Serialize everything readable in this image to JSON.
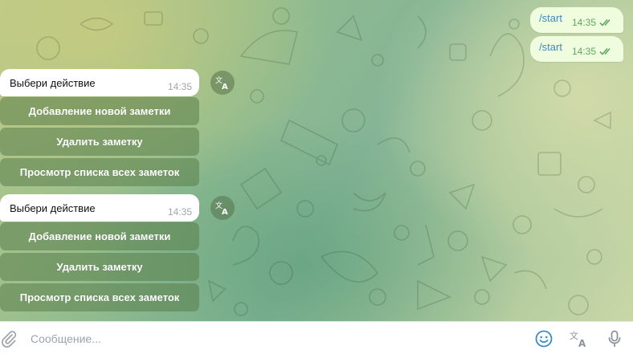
{
  "outgoing": [
    {
      "text": "/start",
      "time": "14:35",
      "status_icon": "double-check-icon"
    },
    {
      "text": "/start",
      "time": "14:35",
      "status_icon": "double-check-icon"
    }
  ],
  "bot_messages": [
    {
      "text": "Выбери действие",
      "time": "14:35",
      "buttons": [
        "Добавление новой заметки",
        "Удалить заметку",
        "Просмотр списка всех заметок"
      ]
    },
    {
      "text": "Выбери действие",
      "time": "14:35",
      "buttons": [
        "Добавление новой заметки",
        "Удалить заметку",
        "Просмотр списка всех заметок"
      ]
    }
  ],
  "composer": {
    "placeholder": "Сообщение...",
    "icons": [
      "paperclip-icon",
      "emoji-icon",
      "translate-icon",
      "microphone-icon"
    ]
  },
  "colors": {
    "outgoing_bubble": "#effdde",
    "link": "#3a8bc6",
    "check": "#5fa862",
    "keyboard_button": "#6c8a5e"
  }
}
